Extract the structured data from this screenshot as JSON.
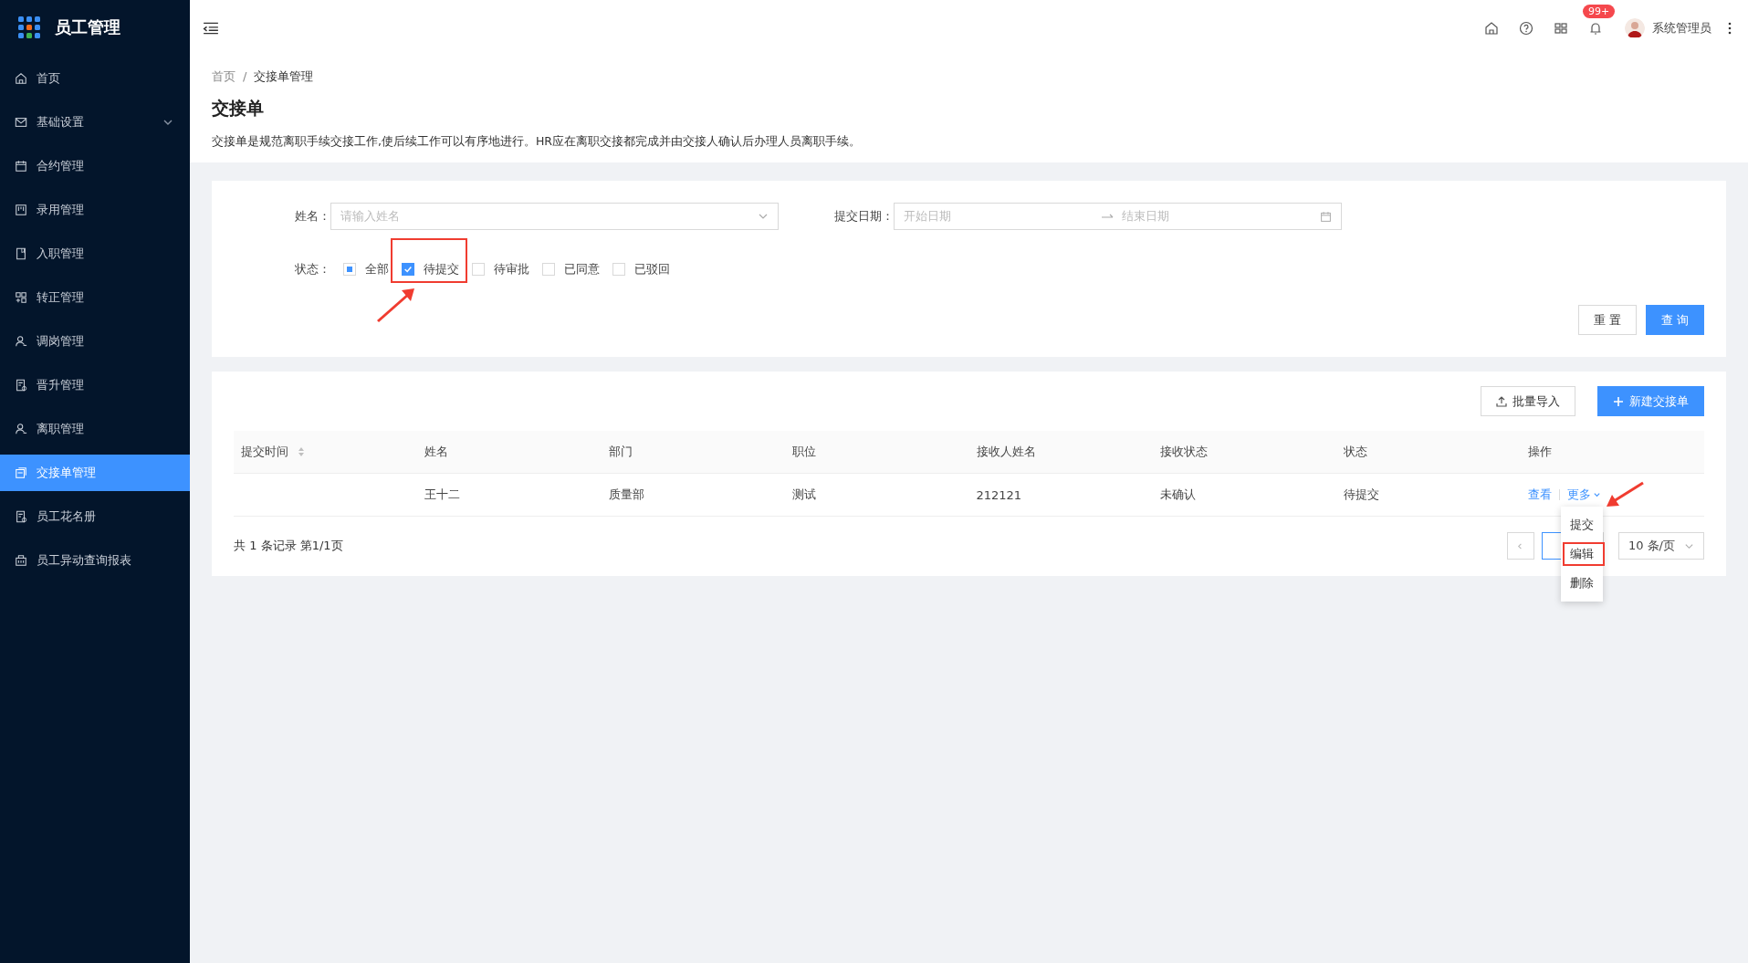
{
  "app": {
    "title": "员工管理"
  },
  "sidebar": {
    "items": [
      {
        "label": "首页",
        "selected": false,
        "has_submenu": false
      },
      {
        "label": "基础设置",
        "selected": false,
        "has_submenu": true
      },
      {
        "label": "合约管理",
        "selected": false,
        "has_submenu": false
      },
      {
        "label": "录用管理",
        "selected": false,
        "has_submenu": false
      },
      {
        "label": "入职管理",
        "selected": false,
        "has_submenu": false
      },
      {
        "label": "转正管理",
        "selected": false,
        "has_submenu": false
      },
      {
        "label": "调岗管理",
        "selected": false,
        "has_submenu": false
      },
      {
        "label": "晋升管理",
        "selected": false,
        "has_submenu": false
      },
      {
        "label": "离职管理",
        "selected": false,
        "has_submenu": false
      },
      {
        "label": "交接单管理",
        "selected": true,
        "has_submenu": false
      },
      {
        "label": "员工花名册",
        "selected": false,
        "has_submenu": false
      },
      {
        "label": "员工异动查询报表",
        "selected": false,
        "has_submenu": false
      }
    ]
  },
  "topbar": {
    "notification_badge": "99+",
    "user_name": "系统管理员"
  },
  "breadcrumb": {
    "items": [
      "首页",
      "交接单管理"
    ],
    "separator": "/"
  },
  "page": {
    "title": "交接单",
    "description": "交接单是规范离职手续交接工作,使后续工作可以有序地进行。HR应在离职交接都完成并由交接人确认后办理人员离职手续。"
  },
  "filters": {
    "name": {
      "label": "姓名：",
      "placeholder": "请输入姓名"
    },
    "date": {
      "label": "提交日期：",
      "start_placeholder": "开始日期",
      "end_placeholder": "结束日期"
    },
    "status": {
      "label": "状态：",
      "options": [
        {
          "label": "全部",
          "kind": "indeterminate",
          "highlighted": false
        },
        {
          "label": "待提交",
          "kind": "checked",
          "highlighted": true
        },
        {
          "label": "待审批",
          "kind": "unchecked",
          "highlighted": false
        },
        {
          "label": "已同意",
          "kind": "unchecked",
          "highlighted": false
        },
        {
          "label": "已驳回",
          "kind": "unchecked",
          "highlighted": false
        }
      ]
    },
    "buttons": [
      {
        "label": "重 置",
        "kind": "default"
      },
      {
        "label": "查 询",
        "kind": "primary"
      }
    ]
  },
  "table": {
    "toolbar": [
      {
        "label": "批量导入",
        "kind": "default"
      },
      {
        "label": "新建交接单",
        "kind": "primary"
      }
    ],
    "columns": [
      {
        "label": "提交时间",
        "sortable": true
      },
      {
        "label": "姓名",
        "sortable": false
      },
      {
        "label": "部门",
        "sortable": false
      },
      {
        "label": "职位",
        "sortable": false
      },
      {
        "label": "接收人姓名",
        "sortable": false
      },
      {
        "label": "接收状态",
        "sortable": false
      },
      {
        "label": "状态",
        "sortable": false
      },
      {
        "label": "操作",
        "sortable": false
      }
    ],
    "rows": [
      {
        "cells": [
          "",
          "王十二",
          "质量部",
          "测试",
          "212121",
          "未确认",
          "待提交"
        ],
        "actions": [
          "查看",
          "更多"
        ]
      }
    ],
    "summary": "共 1 条记录 第1/1页",
    "page_size": "10 条/页",
    "menu": [
      {
        "label": "提交",
        "highlighted": false
      },
      {
        "label": "编辑",
        "highlighted": true
      },
      {
        "label": "删除",
        "highlighted": false
      }
    ]
  }
}
